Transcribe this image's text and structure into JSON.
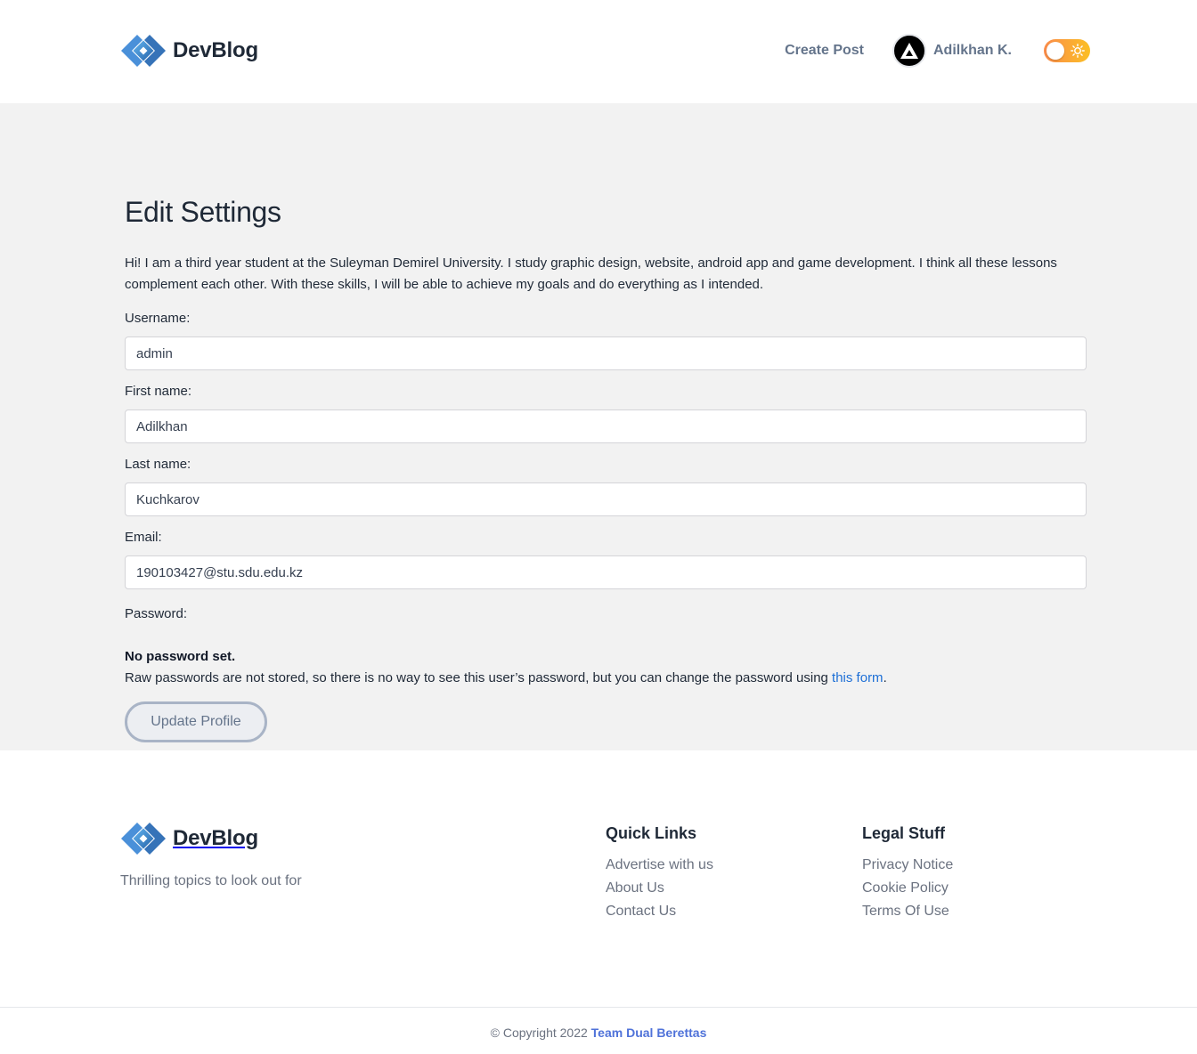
{
  "brand": {
    "name": "DevBlog",
    "tagline": "Thrilling topics to look out for"
  },
  "header": {
    "create_post": "Create Post",
    "user_name": "Adilkhan K."
  },
  "page": {
    "title": "Edit Settings",
    "bio": "Hi! I am a third year student at the Suleyman Demirel University. I study graphic design, website, android app and game development. I think all these lessons complement each other. With these skills, I will be able to achieve my goals and do everything as I intended."
  },
  "form": {
    "username": {
      "label": "Username:",
      "value": "admin"
    },
    "first_name": {
      "label": "First name:",
      "value": "Adilkhan"
    },
    "last_name": {
      "label": "Last name:",
      "value": "Kuchkarov"
    },
    "email": {
      "label": "Email:",
      "value": "190103427@stu.sdu.edu.kz"
    },
    "password": {
      "label": "Password:",
      "status": "No password set.",
      "help_text": "Raw passwords are not stored, so there is no way to see this user’s password, but you can change the password using ",
      "help_link": "this form",
      "help_suffix": "."
    },
    "submit_label": "Update Profile"
  },
  "footer": {
    "quick_links": {
      "title": "Quick Links",
      "items": [
        "Advertise with us",
        "About Us",
        "Contact Us"
      ]
    },
    "legal": {
      "title": "Legal Stuff",
      "items": [
        "Privacy Notice",
        "Cookie Policy",
        "Terms Of Use"
      ]
    },
    "copyright_text": "© Copyright 2022 ",
    "copyright_link": "Team Dual Berettas"
  },
  "colors": {
    "accent": "#4f72d9",
    "link": "#1d6fd6",
    "toggle_start": "#fb8c4b",
    "toggle_end": "#fbbf24",
    "main_bg": "#f2f2f2"
  },
  "icons": {
    "logo": "devblog-logo-icon",
    "avatar": "avatar-triangle-icon",
    "theme": "sun-icon"
  }
}
